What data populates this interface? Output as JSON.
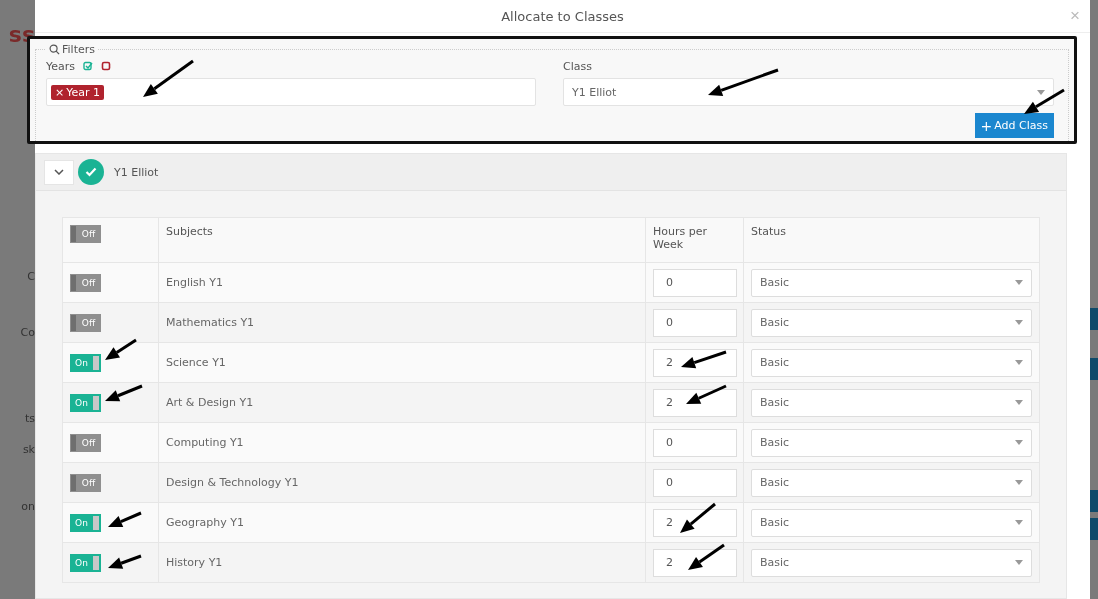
{
  "backdrop": {
    "fragments": [
      "ss",
      "C",
      "Co",
      "ts",
      "sk",
      "on"
    ]
  },
  "window": {
    "title": "Allocate to Classes",
    "close": "×"
  },
  "filters": {
    "legend": "Filters",
    "years": {
      "label": "Years",
      "tags": [
        {
          "label": "Year 1",
          "remove": "×"
        }
      ]
    },
    "class": {
      "label": "Class",
      "value": "Y1 Elliot"
    },
    "add_button": {
      "icon": "+",
      "label": "Add Class"
    }
  },
  "class_panel": {
    "title": "Y1 Elliot",
    "expanded": true,
    "done": true,
    "table": {
      "header_toggle": {
        "on": false,
        "label": "Off"
      },
      "columns": [
        "Subjects",
        "Hours per Week",
        "Status"
      ],
      "rows": [
        {
          "toggle": {
            "on": false,
            "label": "Off"
          },
          "subject": "English Y1",
          "hours": "0",
          "status": "Basic"
        },
        {
          "toggle": {
            "on": false,
            "label": "Off"
          },
          "subject": "Mathematics Y1",
          "hours": "0",
          "status": "Basic"
        },
        {
          "toggle": {
            "on": true,
            "label": "On"
          },
          "subject": "Science Y1",
          "hours": "2",
          "status": "Basic"
        },
        {
          "toggle": {
            "on": true,
            "label": "On"
          },
          "subject": "Art & Design Y1",
          "hours": "2",
          "status": "Basic"
        },
        {
          "toggle": {
            "on": false,
            "label": "Off"
          },
          "subject": "Computing Y1",
          "hours": "0",
          "status": "Basic"
        },
        {
          "toggle": {
            "on": false,
            "label": "Off"
          },
          "subject": "Design & Technology Y1",
          "hours": "0",
          "status": "Basic"
        },
        {
          "toggle": {
            "on": true,
            "label": "On"
          },
          "subject": "Geography Y1",
          "hours": "2",
          "status": "Basic"
        },
        {
          "toggle": {
            "on": true,
            "label": "On"
          },
          "subject": "History Y1",
          "hours": "2",
          "status": "Basic"
        }
      ]
    }
  }
}
